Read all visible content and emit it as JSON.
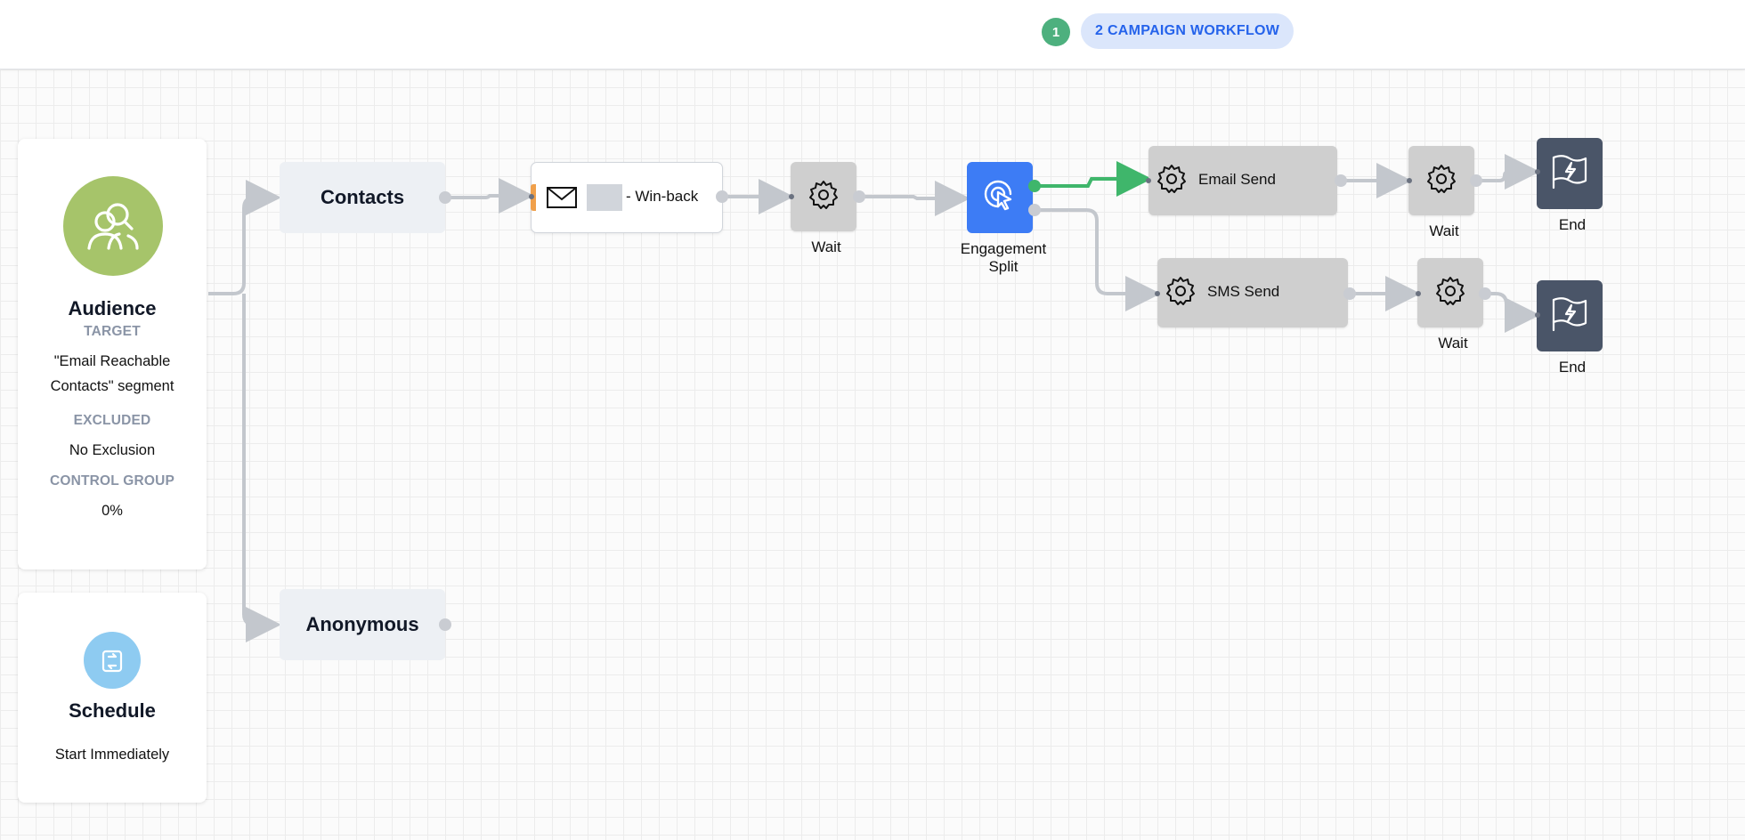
{
  "header": {
    "step_number": "1",
    "step_label": "2 CAMPAIGN WORKFLOW"
  },
  "audience": {
    "title": "Audience",
    "target_label": "TARGET",
    "target_value_line1": "\"Email Reachable",
    "target_value_line2": "Contacts\" segment",
    "excluded_label": "EXCLUDED",
    "excluded_value": "No Exclusion",
    "control_label": "CONTROL GROUP",
    "control_value": "0%",
    "icon": "audience-icon",
    "icon_color": "#a6c46a"
  },
  "schedule": {
    "title": "Schedule",
    "value": "Start Immediately",
    "icon": "schedule-icon",
    "icon_color": "#8ecbf1"
  },
  "groups": {
    "contacts": "Contacts",
    "anonymous": "Anonymous"
  },
  "nodes": {
    "email": {
      "label": "- Win-back",
      "icon": "envelope-icon"
    },
    "wait1": {
      "caption": "Wait",
      "icon": "gear-icon"
    },
    "split": {
      "caption_line1": "Engagement",
      "caption_line2": "Split",
      "icon": "click-icon",
      "color": "#3d7cf5"
    },
    "email_send": {
      "label": "Email Send",
      "icon": "gear-icon"
    },
    "sms_send": {
      "label": "SMS Send",
      "icon": "gear-icon"
    },
    "wait2": {
      "caption": "Wait",
      "icon": "gear-icon"
    },
    "wait3": {
      "caption": "Wait",
      "icon": "gear-icon"
    },
    "end1": {
      "caption": "End",
      "icon": "flag-icon"
    },
    "end2": {
      "caption": "End",
      "icon": "flag-icon"
    }
  },
  "colors": {
    "accent_green": "#3fb66b",
    "accent_blue": "#2563eb",
    "end_node": "#4a5568"
  }
}
